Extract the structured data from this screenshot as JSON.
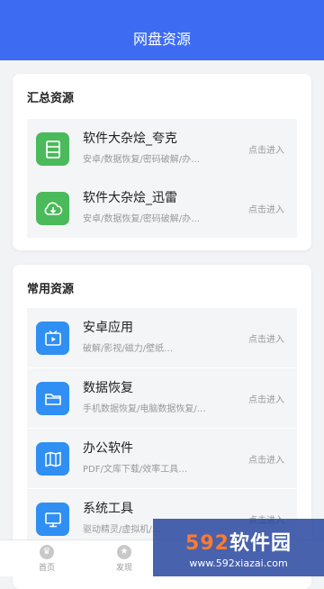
{
  "appbar": {
    "title": "网盘资源"
  },
  "sections": [
    {
      "title": "汇总资源",
      "items": [
        {
          "icon": "storage-icon",
          "title": "软件大杂烩_夸克",
          "subtitle": "安卓/数据恢复/密码破解/办…",
          "action": "点击进入"
        },
        {
          "icon": "cloud-download-icon",
          "title": "软件大杂烩_迅雷",
          "subtitle": "安卓/数据恢复/密码破解/办…",
          "action": "点击进入"
        }
      ]
    },
    {
      "title": "常用资源",
      "items": [
        {
          "icon": "tv-icon",
          "title": "安卓应用",
          "subtitle": "破解/影视/磁力/壁纸…",
          "action": "点击进入"
        },
        {
          "icon": "folder-icon",
          "title": "数据恢复",
          "subtitle": "手机数据恢复/电脑数据恢复/…",
          "action": "点击进入"
        },
        {
          "icon": "book-icon",
          "title": "办公软件",
          "subtitle": "PDF/文库下载/效率工具…",
          "action": "点击进入"
        },
        {
          "icon": "monitor-icon",
          "title": "系统工具",
          "subtitle": "驱动精灵/虚拟机/…",
          "action": "点击进入"
        }
      ]
    }
  ],
  "tabbar": {
    "tabs": [
      {
        "label": "首页",
        "icon": "home-icon"
      },
      {
        "label": "发现",
        "icon": "star-icon"
      }
    ]
  },
  "watermark": {
    "brand_num": "592",
    "brand_text": "软件园",
    "url": "www.592xiazai.com"
  },
  "colors": {
    "primary": "#3d6cf3",
    "green": "#4aba5a",
    "blue": "#2f8ff2"
  }
}
